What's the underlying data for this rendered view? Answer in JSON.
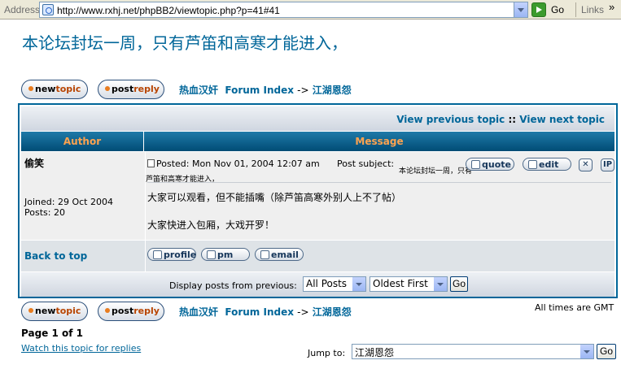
{
  "browser": {
    "address_label": "Address",
    "url": "http://www.rxhj.net/phpBB2/viewtopic.php?p=41#41",
    "go_label": "Go",
    "links_label": "Links",
    "chevron": "»"
  },
  "topic": {
    "title": "本论坛封坛一周，只有芦笛和高寒才能进入，"
  },
  "buttons": {
    "newtopic_a": "new",
    "newtopic_b": "topic",
    "postreply_a": "post",
    "postreply_b": "reply"
  },
  "nav": {
    "site": "热血汉奸",
    "forum_index": "Forum Index",
    "arrow": "->",
    "forum": "江湖恩怨"
  },
  "topic_nav": {
    "previous": "View previous topic",
    "sep": "::",
    "next": "View next topic"
  },
  "table": {
    "author_header": "Author",
    "message_header": "Message"
  },
  "post": {
    "author": "偷笑",
    "joined": "Joined: 29 Oct 2004",
    "posts": "Posts: 20",
    "posted": "Posted: Mon Nov 01, 2004 12:07 am",
    "subject_label": "Post subject:",
    "subject": "本论坛封坛一周，只有芦笛和高寒才能进入，",
    "line1": "大家可以观看，但不能插嘴（除芦笛高寒外别人上不了帖）",
    "line2": "大家快进入包厢，大戏开罗！",
    "quote_label": "quote",
    "edit_label": "edit",
    "delete_glyph": "✕",
    "ip_label": "IP"
  },
  "post_footer": {
    "back_to_top": "Back to top",
    "profile_label": "profile",
    "pm_label": "pm",
    "email_label": "email"
  },
  "display": {
    "label": "Display posts from previous:",
    "days_value": "All Posts",
    "order_value": "Oldest First",
    "go_label": "Go"
  },
  "footer": {
    "timezone": "All times are GMT",
    "page_info": "Page 1 of 1",
    "watch": "Watch this topic for replies",
    "jump_label": "Jump to:",
    "jump_value": "江湖恩怨",
    "go_label": "Go"
  }
}
